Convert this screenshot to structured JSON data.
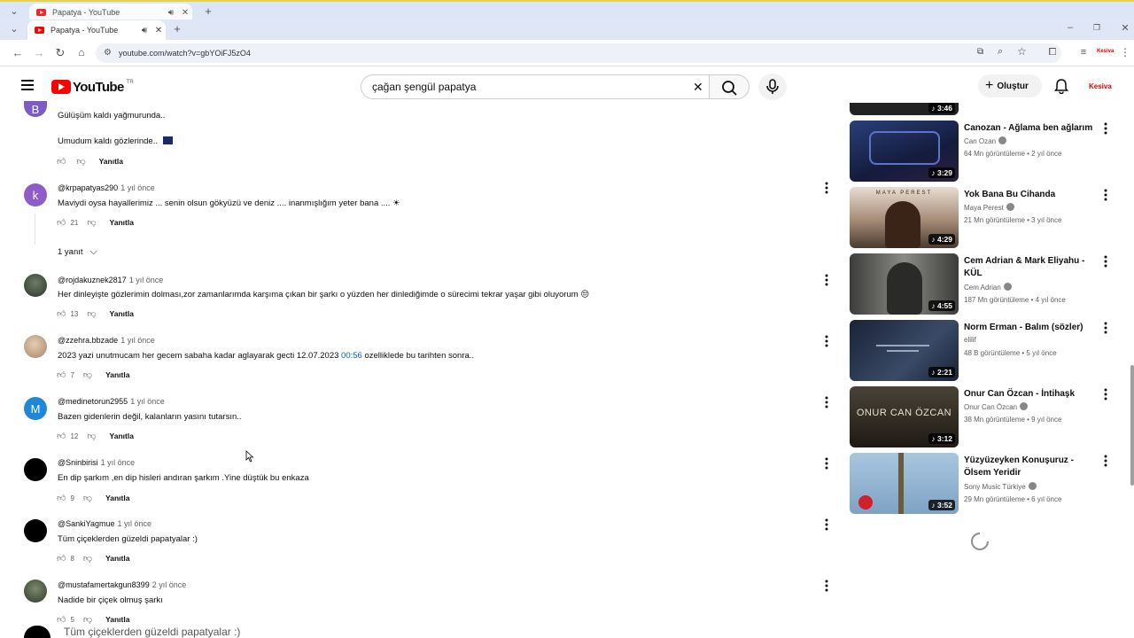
{
  "browser": {
    "ghost_tab_title": "Papatya - YouTube",
    "tab_title": "Papatya - YouTube",
    "url": "youtube.com/watch?v=gbYOiFJ5zO4"
  },
  "header": {
    "logo_text": "YouTube",
    "logo_region": "TR",
    "search_value": "çağan şengül papatya",
    "create_label": "Oluştur",
    "account_label": "Kesiva"
  },
  "comments": [
    {
      "line1": "Gülüşüm kaldı yağmurunda..",
      "line2": "Umudum kaldı gözlerinde..",
      "avatar": "B",
      "avatar_color": "#7c5cc4",
      "likes": "",
      "reply": "Yanıtla"
    },
    {
      "author": "@krpapatyas290",
      "time": "1 yıl önce",
      "text": "Maviydi oysa hayallerimiz ...  senin olsun gökyüzü ve deniz .... inanmışlığım yeter bana .... ☀",
      "avatar": "k",
      "avatar_color": "#8e5cc8",
      "likes": "21",
      "reply": "Yanıtla",
      "replies_label": "1 yanıt"
    },
    {
      "author": "@rojdakuznek2817",
      "time": "1 yıl önce",
      "text": "Her dinleyişte gözlerimin dolması,zor zamanlarımda karşıma çıkan bir şarkı o yüzden her dinlediğimde o sürecimi tekrar yaşar gibi oluyorum 😔",
      "avatar": "",
      "avatar_color": "#3d4a3a",
      "likes": "13",
      "reply": "Yanıtla"
    },
    {
      "author": "@zzehra.bbzade",
      "time": "1 yıl önce",
      "text_before": "2023 yazi unutmucam her gecem sabaha kadar aglayarak gecti 12.07.2023 ",
      "timestamp": "00:56",
      "text_after": " ozelliklede bu tarihten sonra..",
      "avatar": "",
      "avatar_color": "#c9a98a",
      "likes": "7",
      "reply": "Yanıtla"
    },
    {
      "author": "@medinetorun2955",
      "time": "1 yıl önce",
      "text": "Bazen gidenlerin değil, kalanların yasını tutarsın..",
      "avatar": "M",
      "avatar_color": "#1e88d6",
      "likes": "12",
      "reply": "Yanıtla"
    },
    {
      "author": "@Sninbirisi",
      "time": "1 yıl önce",
      "text": "En dip şarkım ,en dip hisleri andıran şarkım .Yine düştük bu enkaza",
      "avatar": "",
      "avatar_color": "#000000",
      "likes": "9",
      "reply": "Yanıtla"
    },
    {
      "author": "@SankiYagmue",
      "time": "1 yıl önce",
      "text": "Tüm çiçeklerden güzeldi papatyalar :)",
      "avatar": "",
      "avatar_color": "#000000",
      "likes": "8",
      "reply": "Yanıtla"
    },
    {
      "author": "@mustafamertakgun8399",
      "time": "2 yıl önce",
      "text": "Nadide bir çiçek olmuş şarkı",
      "avatar": "",
      "avatar_color": "#44503f",
      "likes": "5",
      "reply": "Yanıtla"
    }
  ],
  "ghost_comment_text": "Tüm çiçeklerden güzeldi papatyalar :)",
  "sidebar": {
    "top_duration": "3:46",
    "items": [
      {
        "title": "Canozan - Ağlama ben ağlarım",
        "channel": "Can Ozan",
        "meta": "64 Mn görüntüleme • 2 yıl önce",
        "duration": "3:29",
        "color": "#1c2c5a"
      },
      {
        "title": "Yok Bana Bu Cihanda",
        "channel": "Maya Perest",
        "meta": "21 Mn görüntüleme • 3 yıl önce",
        "duration": "4:29",
        "color": "#8a7260",
        "thumb_text": "MAYA PEREST"
      },
      {
        "title": "Cem Adrian & Mark Eliyahu - KÜL",
        "channel": "Cem Adrian",
        "meta": "187 Mn görüntüleme • 4 yıl önce",
        "duration": "4:55",
        "color": "#5a5a58"
      },
      {
        "title": "Norm Erman - Balım (sözler)",
        "channel": "elilif",
        "meta": "48 B görüntüleme • 5 yıl önce",
        "duration": "2:21",
        "color": "#23304a"
      },
      {
        "title": "Onur Can Özcan - İntihaşk",
        "channel": "Onur Can Özcan",
        "meta": "38 Mn görüntüleme • 9 yıl önce",
        "duration": "3:12",
        "color": "#2e2a24",
        "thumb_text": "ONUR CAN ÖZCAN"
      },
      {
        "title": "Yüzyüzeyken Konuşuruz - Ölsem Yeridir",
        "channel": "Sony Music Türkiye",
        "meta": "29 Mn görüntüleme • 6 yıl önce",
        "duration": "3:52",
        "color": "#8fb2d2"
      }
    ]
  }
}
